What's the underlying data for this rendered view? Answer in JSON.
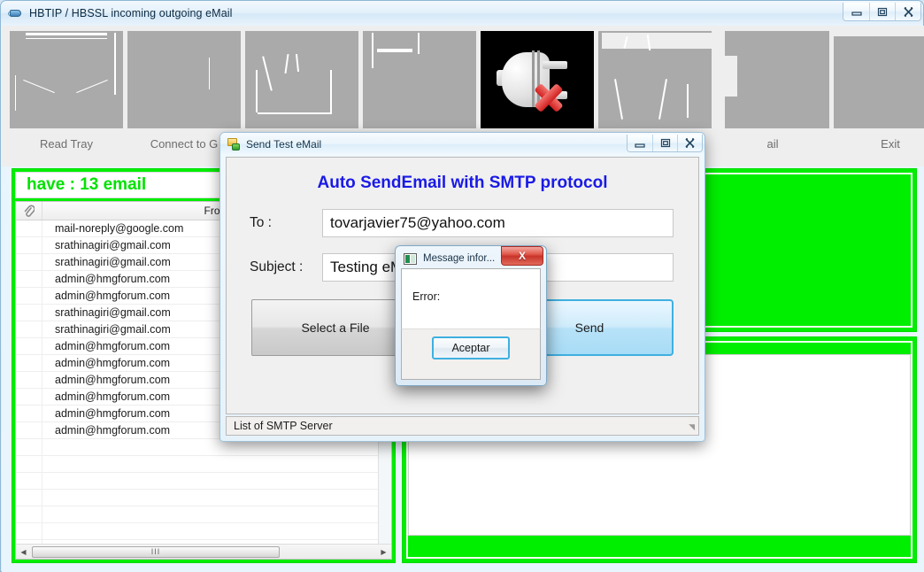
{
  "window": {
    "title": "HBTIP / HBSSL incoming outgoing eMail",
    "app_icon": "mail-globe-icon",
    "controls": {
      "minimize": "minimize-icon",
      "restore": "restore-icon",
      "close": "close-icon"
    }
  },
  "toolbar": {
    "buttons": [
      {
        "label": "Read Tray",
        "icon": "tray-icon"
      },
      {
        "label": "Connect to G",
        "icon": "connect-icon"
      },
      {
        "label": "",
        "icon": "mailbox-icon"
      },
      {
        "label": "",
        "icon": "document-icon"
      },
      {
        "label": "",
        "icon": "disconnect-plug-icon"
      },
      {
        "label": "",
        "icon": "printer-icon"
      },
      {
        "label": "ail",
        "icon": "send-mail-icon"
      },
      {
        "label": "Exit",
        "icon": "exit-icon"
      }
    ]
  },
  "mail_list": {
    "status": "have : 13 email",
    "columns": [
      "attachment-icon",
      "From"
    ],
    "rows": [
      {
        "from": "mail-noreply@google.com"
      },
      {
        "from": "srathinagiri@gmail.com"
      },
      {
        "from": "srathinagiri@gmail.com"
      },
      {
        "from": "admin@hmgforum.com"
      },
      {
        "from": "admin@hmgforum.com"
      },
      {
        "from": "srathinagiri@gmail.com"
      },
      {
        "from": "srathinagiri@gmail.com"
      },
      {
        "from": "admin@hmgforum.com"
      },
      {
        "from": "admin@hmgforum.com"
      },
      {
        "from": "admin@hmgforum.com"
      },
      {
        "from": "admin@hmgforum.com"
      },
      {
        "from": "admin@hmgforum.com"
      },
      {
        "from": "admin@hmgforum.com"
      }
    ],
    "hscroll_grip": "III"
  },
  "colors": {
    "panel_green": "#00ee00",
    "status_green": "#00e200",
    "heading_blue": "#1a1ae6",
    "close_red": "#c8342a"
  },
  "send_dialog": {
    "title": "Send Test eMail",
    "icon": "send-mail-icon",
    "heading": "Auto SendEmail with SMTP protocol",
    "to_label": "To :",
    "to_value": "tovarjavier75@yahoo.com",
    "to_placeholder": "",
    "subject_label": "Subject :",
    "subject_value": "Testing eMail",
    "subject_placeholder": "",
    "select_file_label": "Select a File",
    "send_label": "Send",
    "status": "List of SMTP Server",
    "controls": {
      "minimize": "minimize-icon",
      "restore": "restore-icon",
      "close": "close-icon"
    }
  },
  "message_box": {
    "title": "Message infor...",
    "icon": "message-info-icon",
    "close_label": "X",
    "body_text": "Error:",
    "accept_label": "Aceptar"
  }
}
